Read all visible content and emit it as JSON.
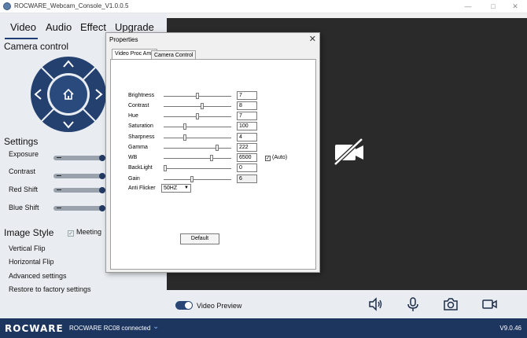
{
  "window": {
    "title": "ROCWARE_Webcam_Console_V1.0.0.5",
    "controls": [
      "—",
      "□",
      "✕"
    ]
  },
  "tabs": [
    {
      "label": "Video"
    },
    {
      "label": "Audio"
    },
    {
      "label": "Effect"
    },
    {
      "label": "Upgrade"
    }
  ],
  "camera_control": {
    "title": "Camera control",
    "home_icon": "home-icon"
  },
  "settings": {
    "title": "Settings",
    "items": [
      {
        "label": "Exposure",
        "level": 1.0
      },
      {
        "label": "Contrast",
        "level": 1.0
      },
      {
        "label": "Red Shift",
        "level": 1.0
      },
      {
        "label": "Blue Shift",
        "level": 1.0
      }
    ]
  },
  "image_style": {
    "title": "Image Style",
    "meeting_label": "Meeting",
    "menu": [
      "Vertical Flip",
      "Horizontal Flip",
      "Advanced settings",
      "Restore to factory settings"
    ]
  },
  "bottom_bar": {
    "toggle_label": "Video Preview",
    "toggle_on": true
  },
  "status": {
    "logo": "ROCWARE",
    "device": "ROCWARE RC08 connected",
    "version": "V9.0.46"
  },
  "dialog": {
    "title": "Properties",
    "close": "✕",
    "tabs": [
      "Video Proc Amp",
      "Camera Control"
    ],
    "properties": [
      {
        "label": "Brightness",
        "value": "7",
        "level": 0.5
      },
      {
        "label": "Contrast",
        "value": "8",
        "level": 0.57
      },
      {
        "label": "Hue",
        "value": "7",
        "level": 0.5
      },
      {
        "label": "Saturation",
        "value": "100",
        "level": 0.3
      },
      {
        "label": "Sharpness",
        "value": "4",
        "level": 0.3
      },
      {
        "label": "Gamma",
        "value": "222",
        "level": 0.8
      },
      {
        "label": "WB",
        "value": "6500",
        "level": 0.72,
        "auto_label": "(Auto)",
        "auto_checked": true
      },
      {
        "label": "BackLight",
        "value": "0",
        "level": 0.0
      },
      {
        "label": "Gain",
        "value": "6",
        "level": 0.42
      }
    ],
    "anti_flicker": {
      "label": "Anti Flicker",
      "value": "50HZ"
    },
    "default_button": "Default"
  },
  "colors": {
    "statusbar": "#1d365f",
    "accent": "#233a62",
    "video_bg": "#2a2a2a"
  }
}
